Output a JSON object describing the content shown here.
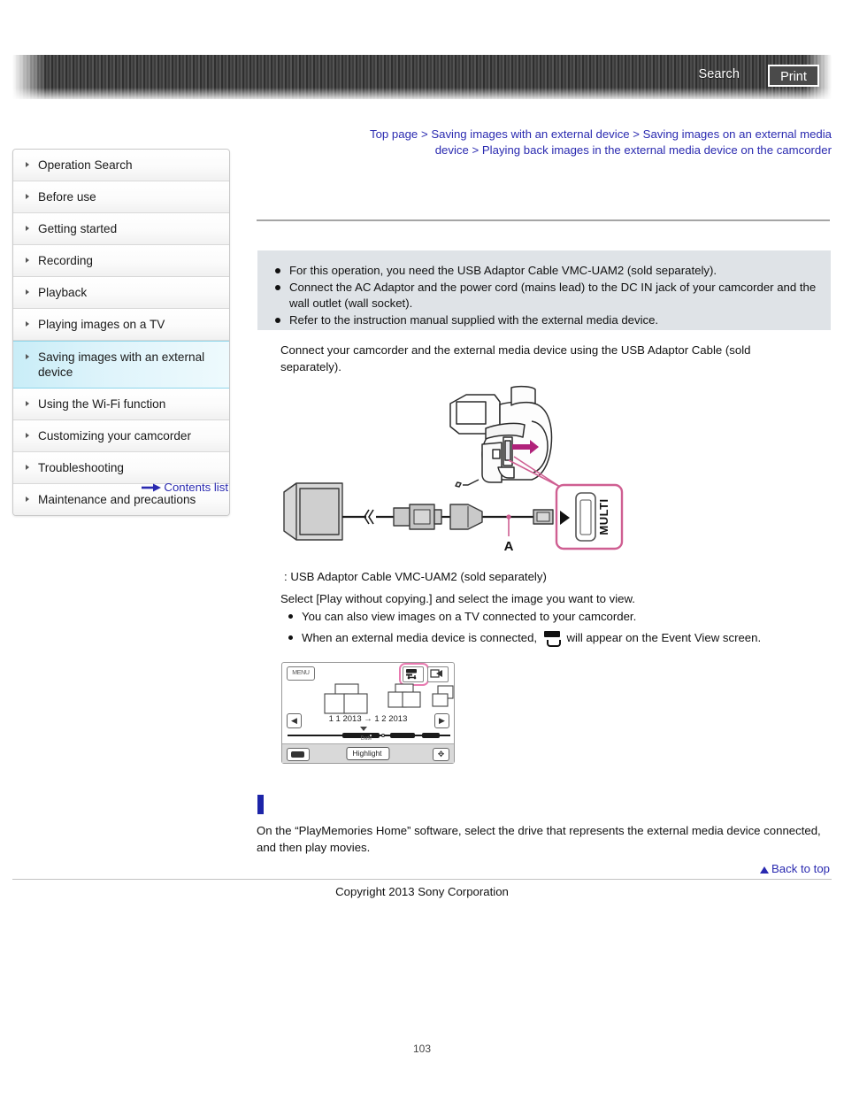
{
  "header": {
    "search_label": "Search",
    "print_label": "Print"
  },
  "breadcrumb": {
    "items": [
      "Top page",
      "Saving images with an external device",
      "Saving images on an external media device",
      "Playing back images in the external media device on the camcorder"
    ],
    "separator": ">"
  },
  "sidebar": {
    "items": [
      {
        "label": "Operation Search",
        "selected": false
      },
      {
        "label": "Before use",
        "selected": false
      },
      {
        "label": "Getting started",
        "selected": false
      },
      {
        "label": "Recording",
        "selected": false
      },
      {
        "label": "Playback",
        "selected": false
      },
      {
        "label": "Playing images on a TV",
        "selected": false
      },
      {
        "label": "Saving images with an external device",
        "selected": true
      },
      {
        "label": "Using the Wi-Fi function",
        "selected": false
      },
      {
        "label": "Customizing your camcorder",
        "selected": false
      },
      {
        "label": "Troubleshooting",
        "selected": false
      },
      {
        "label": "Maintenance and precautions",
        "selected": false
      }
    ],
    "contents_list_label": "Contents list"
  },
  "notice": {
    "bullets": [
      "For this operation, you need the USB Adaptor Cable VMC-UAM2 (sold separately).",
      "Connect the AC Adaptor and the power cord (mains lead) to the DC IN jack of your camcorder and the wall outlet (wall socket).",
      "Refer to the instruction manual supplied with the external media device."
    ]
  },
  "body": {
    "step_connect": "Connect your camcorder and the external media device using the USB Adaptor Cable (sold separately).",
    "cable_caption": ": USB Adaptor Cable VMC-UAM2 (sold separately)",
    "step_select": "Select [Play without copying.] and select the image you want to view.",
    "sub_bullet_1": "You can also view images on a TV connected to your camcorder.",
    "sub_bullet_2_pre": "When an external media device is connected,",
    "sub_bullet_2_post": "will appear on the Event View screen.",
    "pmh_text": "On the “PlayMemories Home” software, select the drive that represents the external media device connected, and then play movies."
  },
  "diagram": {
    "callout_label": "A",
    "port_label": "MULTI"
  },
  "eventview": {
    "menu_label": "MENU",
    "date_range": "1 1 2013 → 1 2 2013",
    "timeline_label": "Date",
    "highlight_label": "Highlight",
    "arrow_left": "◀",
    "arrow_right": "▶",
    "map_icon": "✥"
  },
  "footer": {
    "back_to_top": "Back to top",
    "copyright": "Copyright 2013 Sony Corporation",
    "page_number": "103"
  },
  "colors": {
    "link": "#2a2ab0",
    "notice_bg": "#dfe3e7",
    "selected_nav": "#c9edf7",
    "marker_blue": "#1c24a8",
    "callout_pink": "#cf5f92"
  }
}
